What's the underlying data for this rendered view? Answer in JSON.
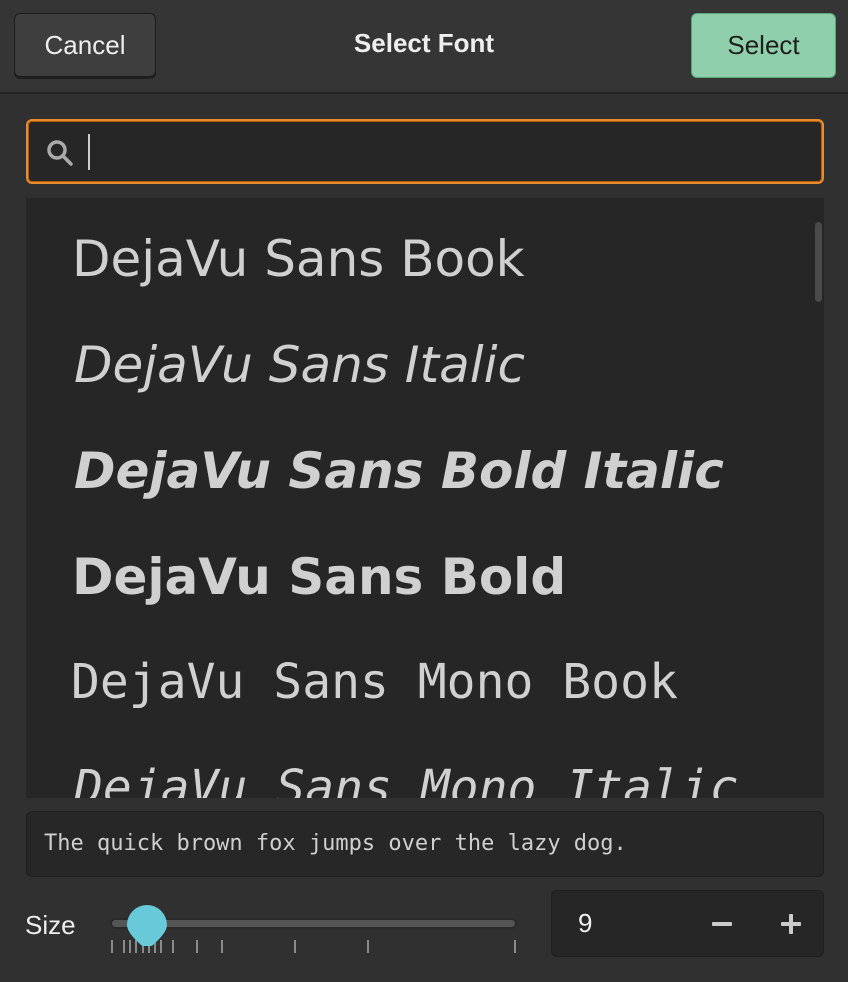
{
  "header": {
    "title": "Select Font",
    "cancel_label": "Cancel",
    "select_label": "Select"
  },
  "search": {
    "value": "",
    "placeholder": "",
    "icon": "search-icon"
  },
  "font_list": {
    "items": [
      {
        "label": "DejaVu Sans Book"
      },
      {
        "label": "DejaVu Sans Italic"
      },
      {
        "label": "DejaVu Sans Bold Italic"
      },
      {
        "label": "DejaVu Sans Bold"
      },
      {
        "label": "DejaVu Sans Mono Book"
      },
      {
        "label": "DejaVu Sans Mono Italic"
      }
    ]
  },
  "preview": {
    "text": "The quick brown fox jumps over the lazy dog."
  },
  "size": {
    "label": "Size",
    "value": "9",
    "minus_icon": "minus-icon",
    "plus_icon": "plus-icon",
    "slider_marks": [
      6,
      8,
      9,
      10,
      11,
      12,
      13,
      14,
      16,
      20,
      24,
      36,
      48,
      72
    ],
    "slider_value": 9,
    "accent_color": "#68c9d9"
  },
  "colors": {
    "select_button": "#8fcfab",
    "focus_border": "#e98b2a"
  }
}
